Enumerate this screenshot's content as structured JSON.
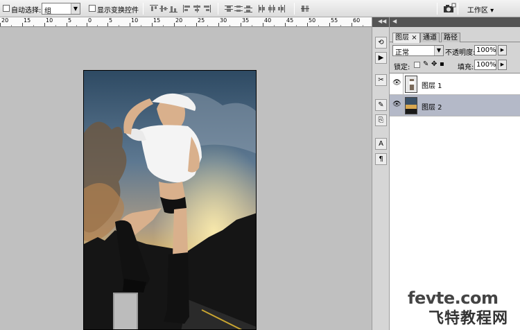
{
  "options_bar": {
    "auto_select_label": "自动选择:",
    "auto_select_value": "组",
    "show_transform_label": "显示变换控件",
    "workspace_label": "工作区 ▾",
    "align_icons": [
      "align-top-icon",
      "align-vcenter-icon",
      "align-bottom-icon",
      "align-left-icon",
      "align-hcenter-icon",
      "align-right-icon"
    ],
    "distribute_icons": [
      "distribute-top-icon",
      "distribute-vcenter-icon",
      "distribute-bottom-icon",
      "distribute-left-icon",
      "distribute-hcenter-icon",
      "distribute-right-icon"
    ],
    "auto_align_icon": "auto-align-icon"
  },
  "ruler": {
    "labels": [
      "20",
      "15",
      "10",
      "5",
      "0",
      "5",
      "10",
      "15",
      "20",
      "25",
      "30",
      "35",
      "40",
      "45",
      "50",
      "55",
      "60"
    ]
  },
  "dock": {
    "collapse_label": "◀◀",
    "icons": [
      "history-icon",
      "actions-icon",
      "tools-preset-icon",
      "brushes-icon",
      "clone-source-icon",
      "character-icon",
      "paragraph-icon"
    ]
  },
  "layers_panel": {
    "collapse_label": "◀",
    "tabs": [
      {
        "label": "图层",
        "close": "×"
      },
      {
        "label": "通道"
      },
      {
        "label": "路径"
      }
    ],
    "blend_mode": "正常",
    "opacity_label": "不透明度:",
    "opacity_value": "100%",
    "lock_label": "锁定:",
    "fill_label": "填充:",
    "fill_value": "100%",
    "layers": [
      {
        "name": "图层 1",
        "visible": true,
        "selected": false
      },
      {
        "name": "图层 2",
        "visible": true,
        "selected": true
      }
    ]
  },
  "watermark": {
    "line1": "fevte.com",
    "line2": "飞特教程网"
  },
  "colors": {
    "selected_layer": "#b4b9c8",
    "panel_header": "#545454",
    "canvas_bg": "#c0c0c0"
  }
}
